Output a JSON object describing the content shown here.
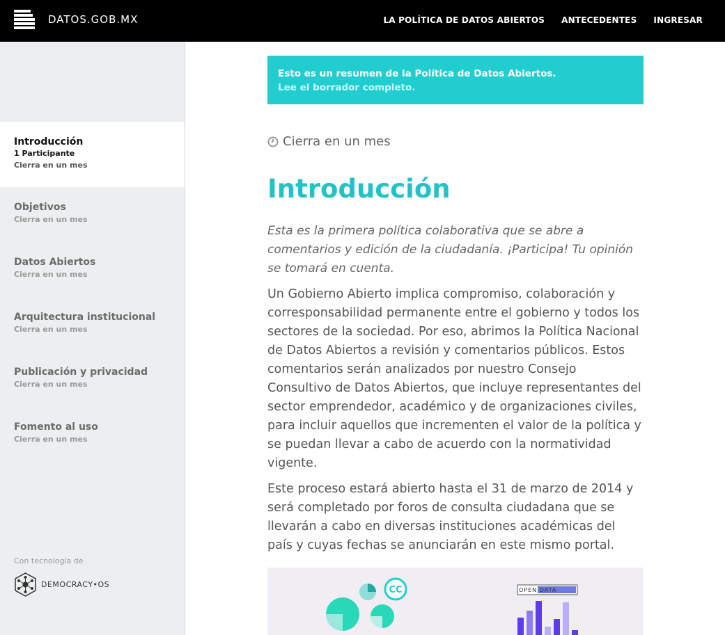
{
  "header": {
    "logo_text": "DATOS.GOB.MX",
    "nav": [
      "LA POLÍTICA DE DATOS ABIERTOS",
      "ANTECEDENTES",
      "INGRESAR"
    ]
  },
  "sidebar": {
    "active": {
      "title": "Introducción",
      "participants": "1 Participante",
      "closes": "Cierra en un mes"
    },
    "items": [
      {
        "title": "Objetivos",
        "closes": "Cierra en un mes"
      },
      {
        "title": "Datos Abiertos",
        "closes": "Cierra en un mes"
      },
      {
        "title": "Arquitectura institucional",
        "closes": "Cierra en un mes"
      },
      {
        "title": "Publicación y privacidad",
        "closes": "Cierra en un mes"
      },
      {
        "title": "Fomento al uso",
        "closes": "Cierra en un mes"
      }
    ],
    "powered_by": "Con tecnología de",
    "powered_logo": "DEMOCRACY•OS"
  },
  "main": {
    "banner_text": "Esto es un resumen de la Política de Datos Abiertos.",
    "banner_link": "Lee el borrador completo.",
    "closes": "Cierra en un mes",
    "title": "Introducción",
    "lead": "Esta es la primera política colaborativa que se abre a comentarios y edición de la ciudadanía. ¡Participa! Tu opinión se tomará en cuenta.",
    "paragraphs": [
      "Un Gobierno Abierto implica compromiso, colaboración y corresponsabilidad permanente entre el gobierno y todos los sectores de la sociedad. Por eso, abrimos la Política Nacional de Datos Abiertos a revisión y comentarios públicos. Estos comentarios serán analizados por nuestro Consejo Consultivo de Datos Abiertos, que incluye representantes del sector emprendedor, académico y de organizaciones civiles, para incluir aquellos que incrementen el valor de la política y se puedan llevar a cabo de acuerdo con la normatividad vigente.",
      "Este proceso estará abierto hasta el 31 de marzo de 2014 y será completado por foros de consulta ciudadana que se llevarán a cabo en diversas instituciones académicas del país y cuyas fechas se anunciarán en este mismo portal."
    ],
    "illustration": {
      "cc_badge": "CC",
      "open_data_label": "OPEN DATA"
    }
  },
  "colors": {
    "accent": "#22cdd0",
    "title": "#22c2c9",
    "topbar": "#000000",
    "sidebar_bg": "#eceeef"
  }
}
